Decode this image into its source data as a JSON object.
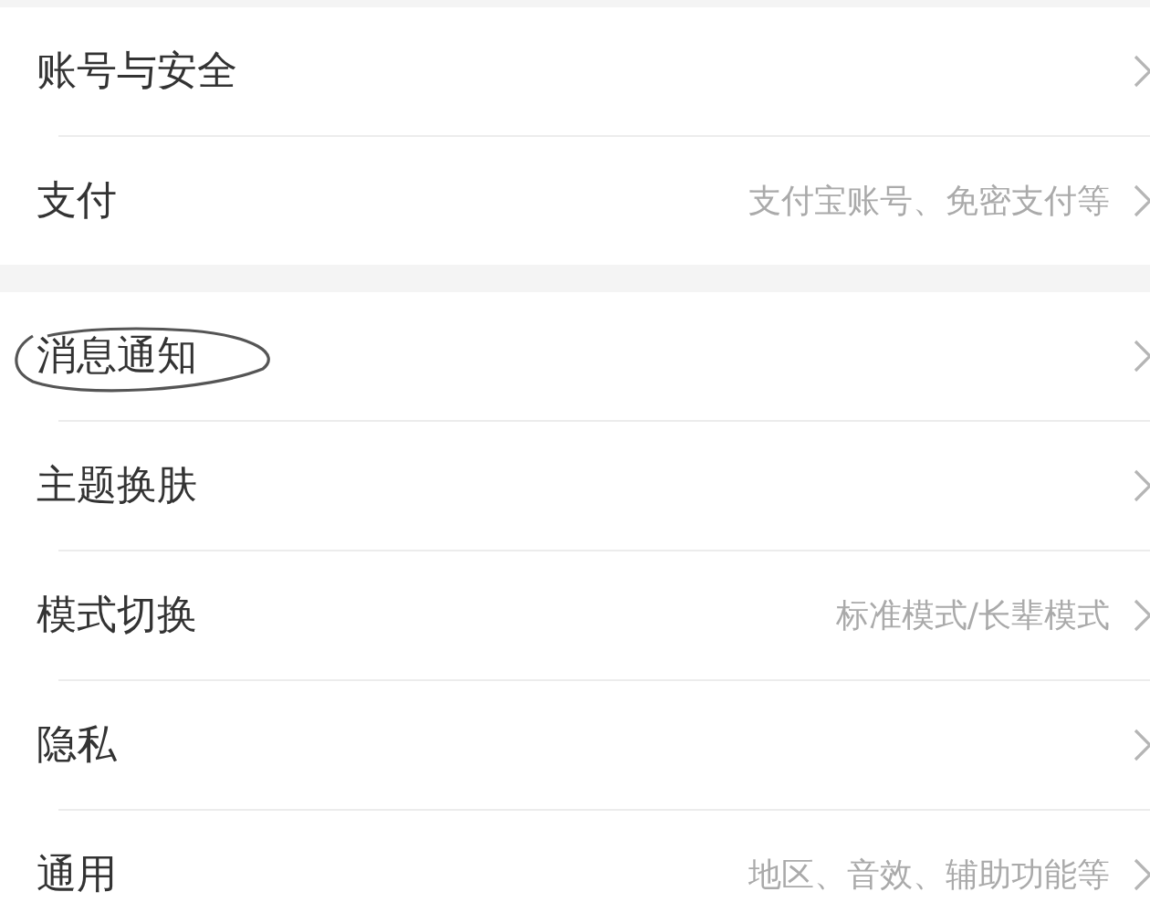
{
  "sections": [
    {
      "items": [
        {
          "label": "账号与安全",
          "circled": false
        },
        {
          "label": "支付",
          "detail": "支付宝账号、免密支付等",
          "circled": false
        }
      ]
    },
    {
      "items": [
        {
          "label": "消息通知",
          "circled": true
        },
        {
          "label": "主题换肤",
          "circled": false
        },
        {
          "label": "模式切换",
          "detail": "标准模式/长辈模式",
          "circled": false
        },
        {
          "label": "隐私",
          "circled": false
        },
        {
          "label": "通用",
          "detail": "地区、音效、辅助功能等",
          "circled": false
        }
      ]
    }
  ]
}
